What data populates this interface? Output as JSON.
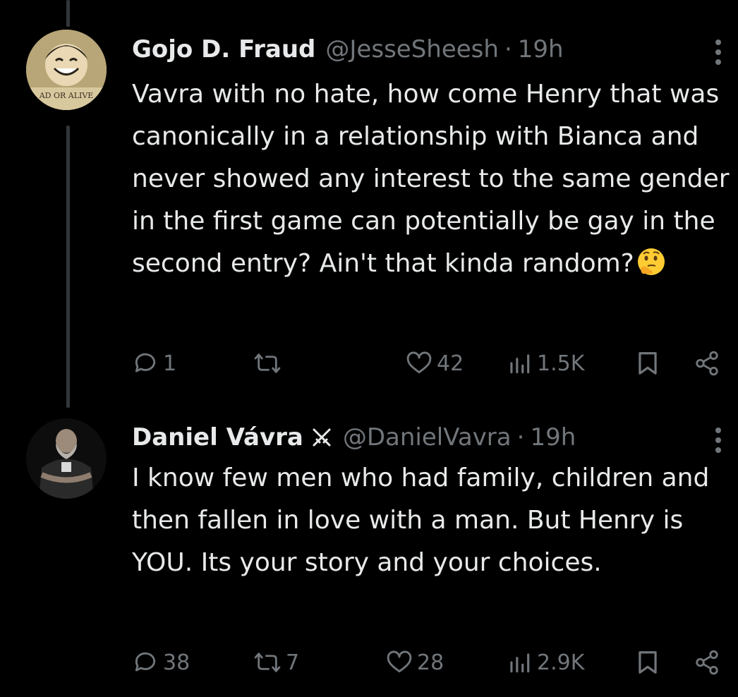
{
  "tweets": [
    {
      "display_name": "Gojo D. Fraud",
      "handle": "@JesseSheesh",
      "separator": "·",
      "time": "19h",
      "avatar_icon": "anime-character-avatar",
      "avatar_text": "AD OR ALIVE",
      "text": "Vavra with no hate, how come Henry that was canonically in a relationship with Bianca and never showed any interest to the same gender in the first game can potentially be gay in the second entry? Ain't that kinda random?",
      "emoji": "thinking-face-emoji",
      "replies": "1",
      "reposts": "",
      "likes": "42",
      "views": "1.5K"
    },
    {
      "display_name": "Daniel Vávra",
      "handle": "@DanielVavra",
      "separator": "·",
      "time": "19h",
      "avatar_icon": "bearded-man-avatar",
      "badge_icon": "crossed-swords-icon",
      "text": "I know few men who had family, children and then fallen in love with a man. But Henry is YOU. Its your story and your choices.",
      "replies": "38",
      "reposts": "7",
      "likes": "28",
      "views": "2.9K"
    }
  ],
  "colors": {
    "background": "#000000",
    "primary_text": "#e7e9ea",
    "secondary_text": "#71767b",
    "thread_line": "#333639"
  }
}
